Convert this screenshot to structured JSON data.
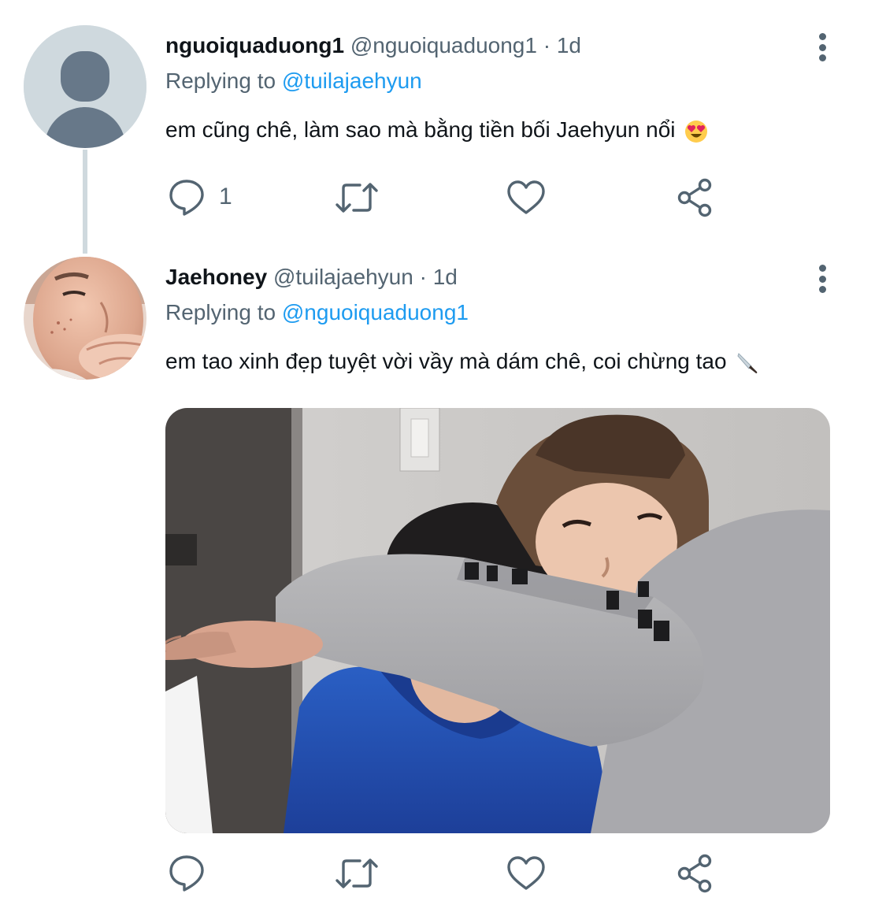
{
  "tweet1": {
    "display_name": "nguoiquaduong1",
    "handle": "@nguoiquaduong1",
    "separator": "·",
    "time": "1d",
    "replying_prefix": "Replying to ",
    "replying_mention": "@tuilajaehyun",
    "text": "em cũng chê, làm sao mà bằng tiền bối Jaehyun nổi",
    "text_emoji": "heart-eyes-emoji",
    "reply_count": "1"
  },
  "tweet2": {
    "display_name": "Jaehoney",
    "handle": "@tuilajaehyun",
    "separator": "·",
    "time": "1d",
    "replying_prefix": "Replying to ",
    "replying_mention": "@nguoiquaduong1",
    "text": "em tao xinh đẹp tuyệt vời vầy mà dám chê, coi chừng tao",
    "text_emoji": "knife-emoji"
  },
  "icons": {
    "reply": "speech-bubble-icon",
    "retweet": "retweet-icon",
    "like": "heart-icon",
    "share": "share-icon",
    "more": "vertical-dots-icon"
  },
  "colors": {
    "text_primary": "#0f1419",
    "text_secondary": "#536471",
    "link": "#1d9bf0",
    "thread_line": "#cfd9de",
    "avatar_default_bg": "#cfd9de",
    "avatar_default_fg": "#677889"
  }
}
